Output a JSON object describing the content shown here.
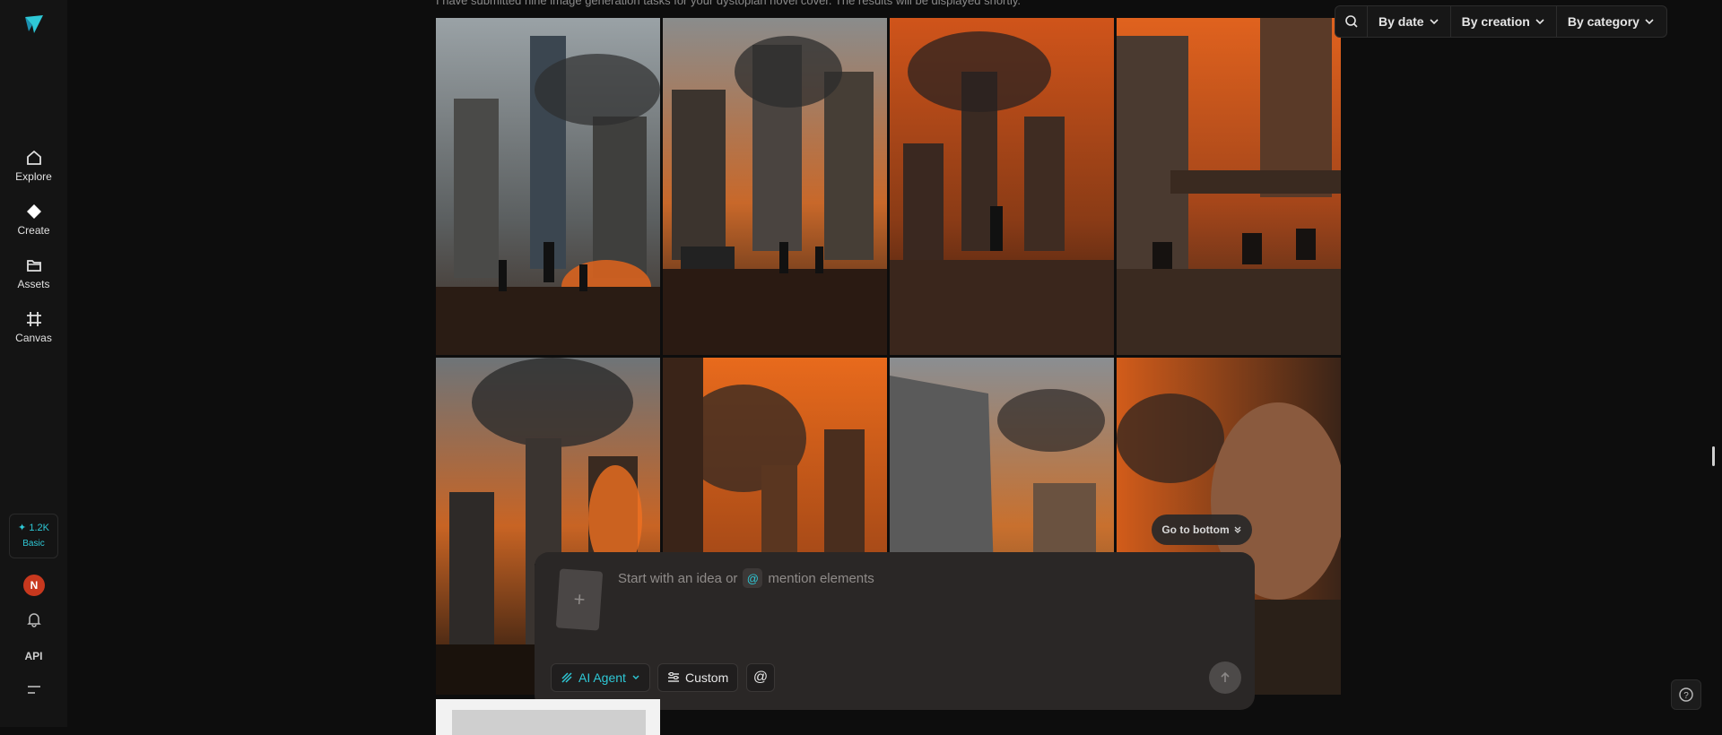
{
  "sidebar": {
    "nav": [
      {
        "label": "Explore",
        "icon": "home-icon"
      },
      {
        "label": "Create",
        "icon": "diamond-icon"
      },
      {
        "label": "Assets",
        "icon": "folder-icon"
      },
      {
        "label": "Canvas",
        "icon": "frame-icon"
      }
    ],
    "credits": {
      "amount": "✦ 1.2K",
      "plan": "Basic"
    },
    "avatar_initial": "N",
    "api_label": "API"
  },
  "header_caption": "I have submitted nine image generation tasks for your dystopian novel cover. The results will be displayed shortly.",
  "filters": {
    "by_date": "By date",
    "by_creation": "By creation",
    "by_category": "By category"
  },
  "gallery": {
    "tiles": [
      {
        "name": "ruined-skyscraper-soldiers-image"
      },
      {
        "name": "tank-soldiers-ruins-image"
      },
      {
        "name": "lone-figure-burning-city-image"
      },
      {
        "name": "soldiers-under-bridge-image"
      },
      {
        "name": "burning-skyline-soldier-image"
      },
      {
        "name": "smoke-towers-image"
      },
      {
        "name": "collapsed-building-street-image"
      },
      {
        "name": "dirty-soldier-portrait-image"
      }
    ]
  },
  "go_to_bottom": "Go to bottom",
  "composer": {
    "prompt_start": "Start with an idea or",
    "prompt_at": "@",
    "prompt_end": "mention elements",
    "agent_label": "AI Agent",
    "custom_label": "Custom",
    "mention_label": "@"
  },
  "colors": {
    "accent": "#2ec8d6",
    "avatar": "#c8381e"
  }
}
